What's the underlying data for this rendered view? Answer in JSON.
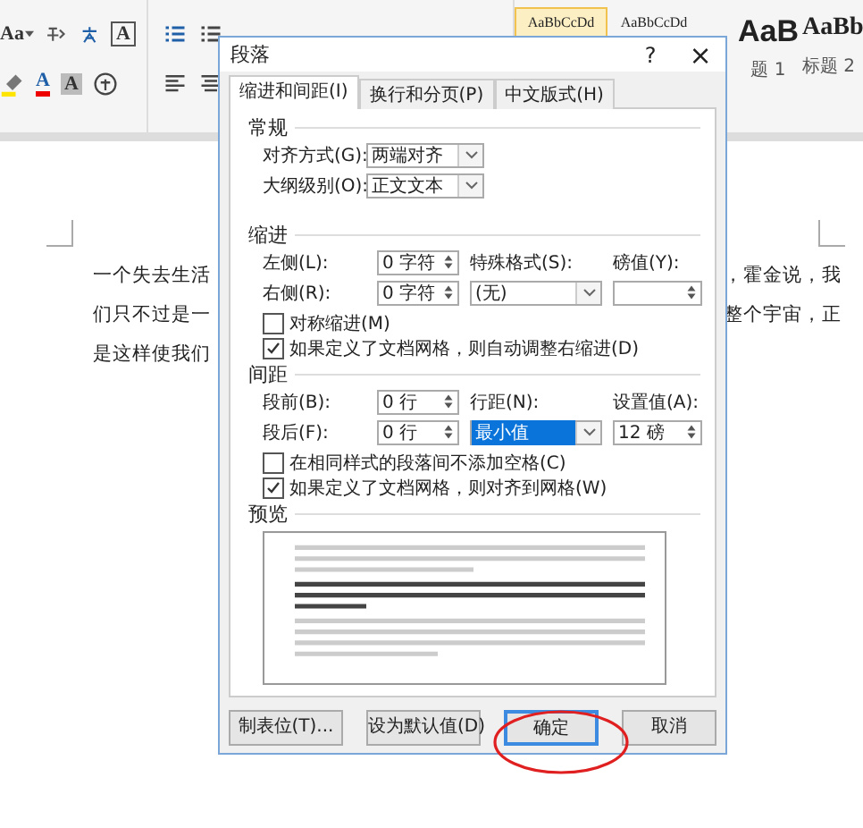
{
  "ribbon": {
    "change_case": "Aa",
    "font_color_glyph": "A",
    "shading_glyph": "A",
    "border_glyph": "A",
    "styles": [
      {
        "sample": "AaBbCcDd",
        "kind": "small",
        "selected": true
      },
      {
        "sample": "AaBbCcDd",
        "kind": "small",
        "selected": false
      },
      {
        "sample": "AaB",
        "kind": "heading1",
        "label": "题 1",
        "selected": false
      },
      {
        "sample": "AaBb",
        "kind": "heading2",
        "label": "标题 2",
        "selected": false
      }
    ]
  },
  "document": {
    "left_lines": [
      "一个失去生活",
      "们只不过是一",
      "是这样使我们"
    ],
    "right_lines": [
      "，霍金说，我",
      "整个宇宙，正"
    ]
  },
  "dialog": {
    "title": "段落",
    "help": "?",
    "close": "×",
    "tabs": [
      {
        "label": "缩进和间距(I)",
        "selected": true
      },
      {
        "label": "换行和分页(P)",
        "selected": false
      },
      {
        "label": "中文版式(H)",
        "selected": false
      }
    ],
    "general": {
      "heading": "常规",
      "alignment": {
        "label": "对齐方式(G):",
        "value": "两端对齐"
      },
      "outline_level": {
        "label": "大纲级别(O):",
        "value": "正文文本"
      }
    },
    "indent": {
      "heading": "缩进",
      "left": {
        "label": "左侧(L):",
        "value": "0 字符"
      },
      "right": {
        "label": "右侧(R):",
        "value": "0 字符"
      },
      "special": {
        "label": "特殊格式(S):",
        "value": "(无)"
      },
      "by": {
        "label": "磅值(Y):"
      },
      "checkboxes": [
        {
          "label": "对称缩进(M)",
          "checked": false
        },
        {
          "label": "如果定义了文档网格，则自动调整右缩进(D)",
          "checked": true
        }
      ]
    },
    "spacing": {
      "heading": "间距",
      "before": {
        "label": "段前(B):",
        "value": "0 行"
      },
      "after": {
        "label": "段后(F):",
        "value": "0 行"
      },
      "line_spacing": {
        "label": "行距(N):",
        "value": "最小值",
        "selected": true
      },
      "at": {
        "label": "设置值(A):",
        "value": "12 磅"
      },
      "checkboxes": [
        {
          "label": "在相同样式的段落间不添加空格(C)",
          "checked": false
        },
        {
          "label": "如果定义了文档网格，则对齐到网格(W)",
          "checked": true
        }
      ]
    },
    "preview": {
      "heading": "预览"
    },
    "buttons": [
      {
        "label": "制表位(T)...",
        "default": false
      },
      {
        "label": "设为默认值(D)",
        "default": false
      },
      {
        "label": "确定",
        "default": true
      },
      {
        "label": "取消",
        "default": false
      }
    ]
  }
}
